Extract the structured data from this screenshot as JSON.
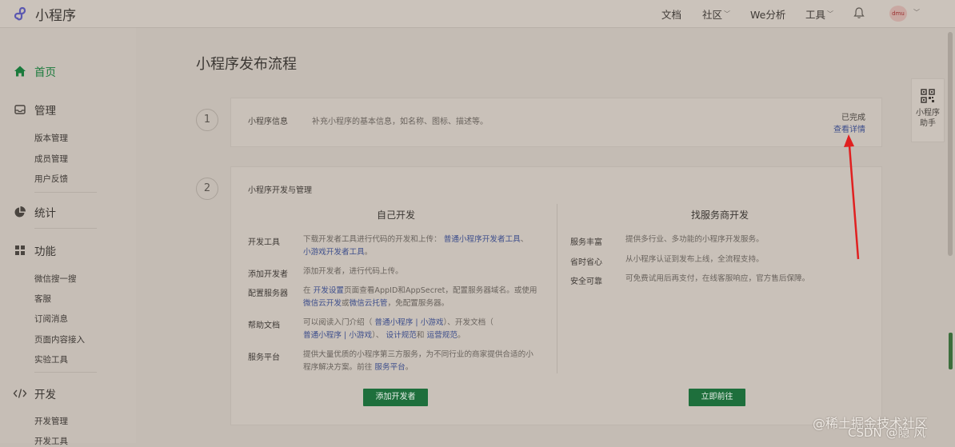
{
  "header": {
    "app_name": "小程序",
    "nav": [
      "文档",
      "社区",
      "We分析",
      "工具"
    ],
    "avatar_text": "dmu"
  },
  "sidebar": {
    "home": "首页",
    "manage": "管理",
    "manage_items": [
      "版本管理",
      "成员管理",
      "用户反馈"
    ],
    "stats": "统计",
    "features": "功能",
    "feature_items": [
      "微信搜一搜",
      "客服",
      "订阅消息",
      "页面内容接入",
      "实验工具"
    ],
    "dev": "开发",
    "dev_items": [
      "开发管理",
      "开发工具"
    ]
  },
  "main": {
    "title": "小程序发布流程",
    "step1": {
      "num": "1",
      "label": "小程序信息",
      "desc": "补充小程序的基本信息，如名称、图标、描述等。",
      "status": "已完成",
      "link": "查看详情"
    },
    "step2": {
      "num": "2",
      "title": "小程序开发与管理",
      "self_dev": {
        "title": "自己开发",
        "rows": [
          {
            "label": "开发工具",
            "lines": [
              [
                "下载开发者工具进行代码的开发和上传： ",
                "普通小程序开发者工具",
                "、"
              ],
              [
                "",
                "小游戏开发者工具",
                "。"
              ]
            ]
          },
          {
            "label": "添加开发者",
            "lines": [
              [
                "添加开发者，进行代码上传。",
                "",
                ""
              ]
            ]
          },
          {
            "label": "配置服务器",
            "lines": [
              [
                "在 ",
                "开发设置",
                "页面查看AppID和AppSecret，配置服务器域名。或使用"
              ],
              [
                "",
                "微信云开发",
                "或"
              ],
              [
                "",
                "微信云托管",
                "，免配置服务器。"
              ]
            ]
          },
          {
            "label": "帮助文档",
            "lines": [
              [
                "可以阅读入门介绍（ ",
                "普通小程序 | 小游戏",
                "）、开发文档（ "
              ],
              [
                "",
                "普通小程序 | 小游戏",
                "）、 "
              ],
              [
                "",
                "设计规范",
                "和 "
              ],
              [
                "",
                "运营规范",
                "。"
              ]
            ]
          },
          {
            "label": "服务平台",
            "lines": [
              [
                "提供大量优质的小程序第三方服务，为不同行业的商家提供合适的小",
                "",
                ""
              ],
              [
                "程序解决方案。前往 ",
                "服务平台",
                "。"
              ]
            ]
          }
        ],
        "button": "添加开发者"
      },
      "vendor_dev": {
        "title": "找服务商开发",
        "rows": [
          {
            "label": "服务丰富",
            "text": "提供多行业、多功能的小程序开发服务。"
          },
          {
            "label": "省时省心",
            "text": "从小程序认证到发布上线，全流程支持。"
          },
          {
            "label": "安全可靠",
            "text": "可免费试用后再支付，在线客服响应，官方售后保障。"
          }
        ],
        "button": "立即前往"
      }
    }
  },
  "helper": {
    "line1": "小程序",
    "line2": "助手"
  },
  "watermark": {
    "line1": "@稀土掘金技术社区",
    "line2": "CSDN @隐 风"
  },
  "colors": {
    "accent": "#1a7a3c",
    "button": "#1e6f3c",
    "link": "#3e4f8c",
    "arrow": "#e02020"
  }
}
